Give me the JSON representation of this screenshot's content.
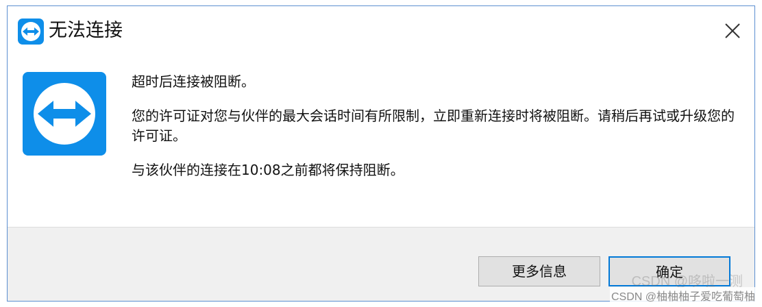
{
  "window": {
    "title": "无法连接",
    "close_icon": "close-icon",
    "title_icon": "teamviewer-logo-icon"
  },
  "content": {
    "app_icon": "teamviewer-logo-icon",
    "line1": "超时后连接被阻断。",
    "line2": "您的许可证对您与伙伴的最大会话时间有所限制，立即重新连接时将被阻断。请稍后再试或升级您的许可证。",
    "line3": "与该伙伴的连接在10:08之前都将保持阻断。"
  },
  "buttons": {
    "more_info": "更多信息",
    "ok": "确定"
  },
  "watermark": {
    "ghost": "CSDN @哆啦一测",
    "text": "CSDN @柚柚柚子爱吃葡萄柚"
  },
  "colors": {
    "brand_blue": "#0e8ee9",
    "border": "#5b8fd0",
    "default_button_border": "#0078d7",
    "footer_bg": "#f0f0f0"
  }
}
